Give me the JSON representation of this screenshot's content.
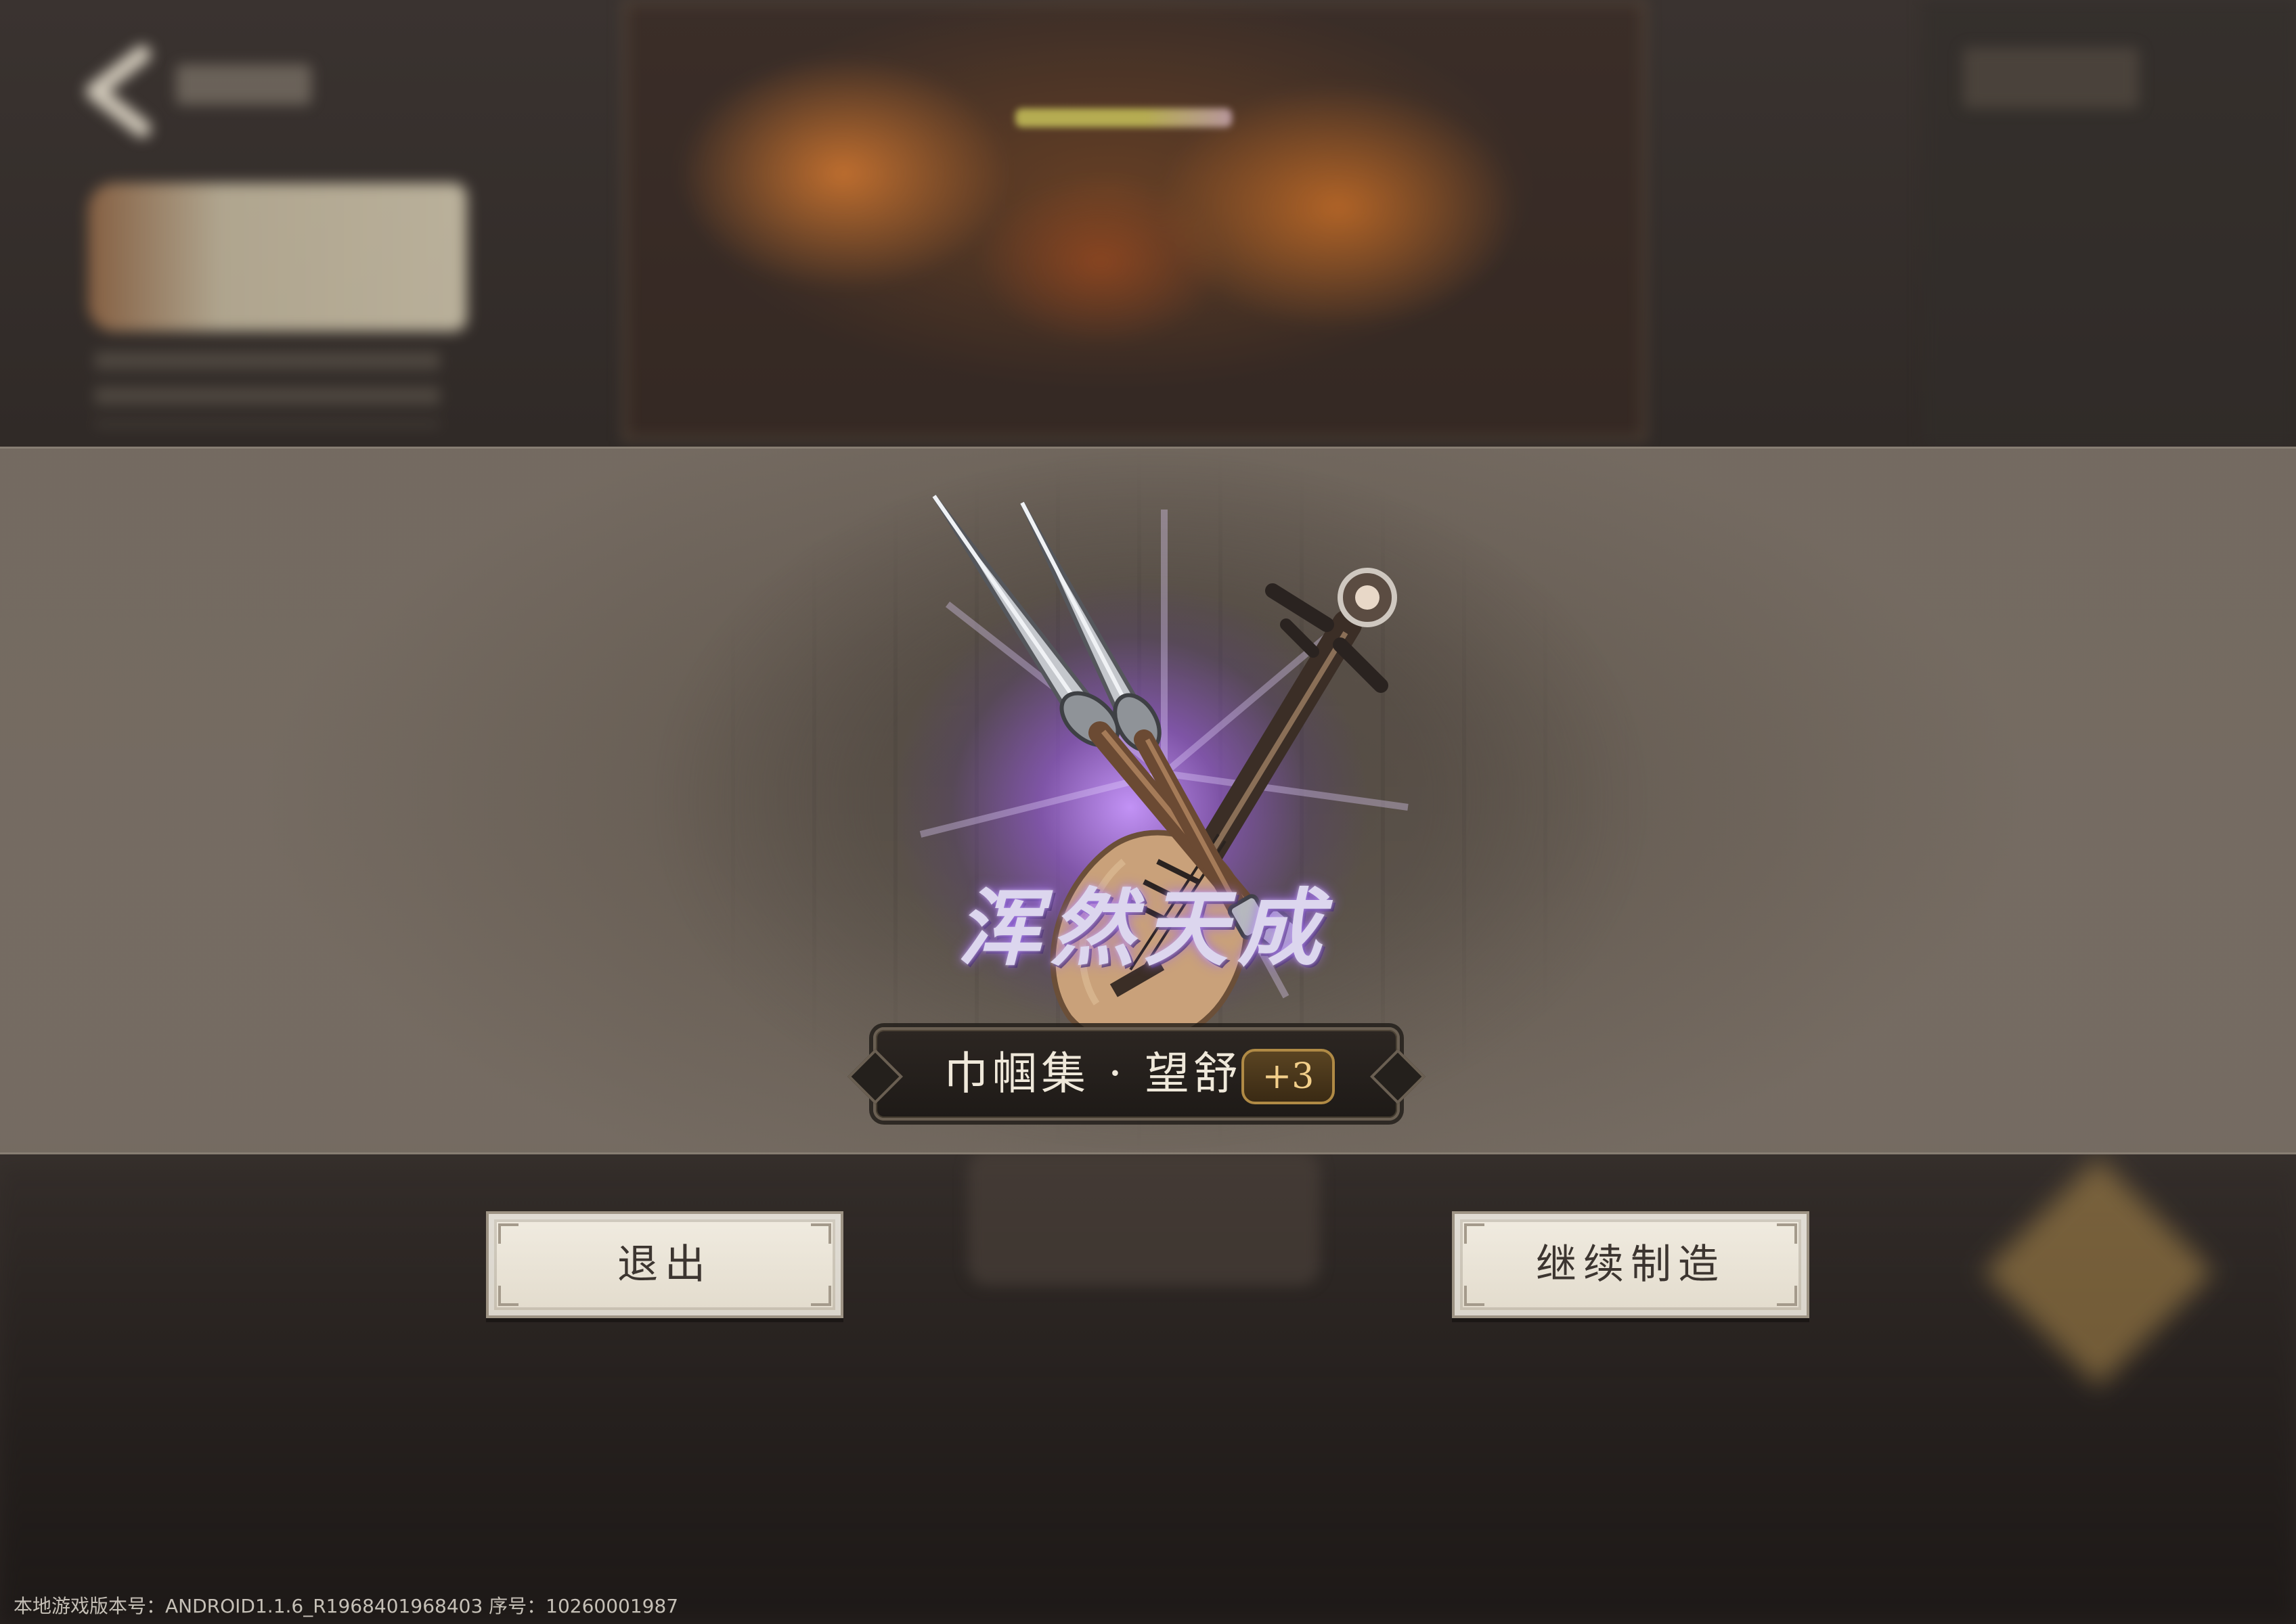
{
  "result": {
    "quality_title": "浑然天成",
    "item_name": "巾帼集 · 望舒",
    "enhance_level": "+3"
  },
  "buttons": {
    "exit_label": "退出",
    "continue_label": "继续制造"
  },
  "footer": {
    "version_text": "本地游戏版本号：ANDROID1.1.6_R1968401968403 序号：10260001987"
  },
  "colors": {
    "glow": "#b27ff0",
    "badge_border": "#b08a45",
    "button_face": "#ece6da"
  },
  "icons": {
    "item_art": "pipa-and-twin-daggers"
  }
}
